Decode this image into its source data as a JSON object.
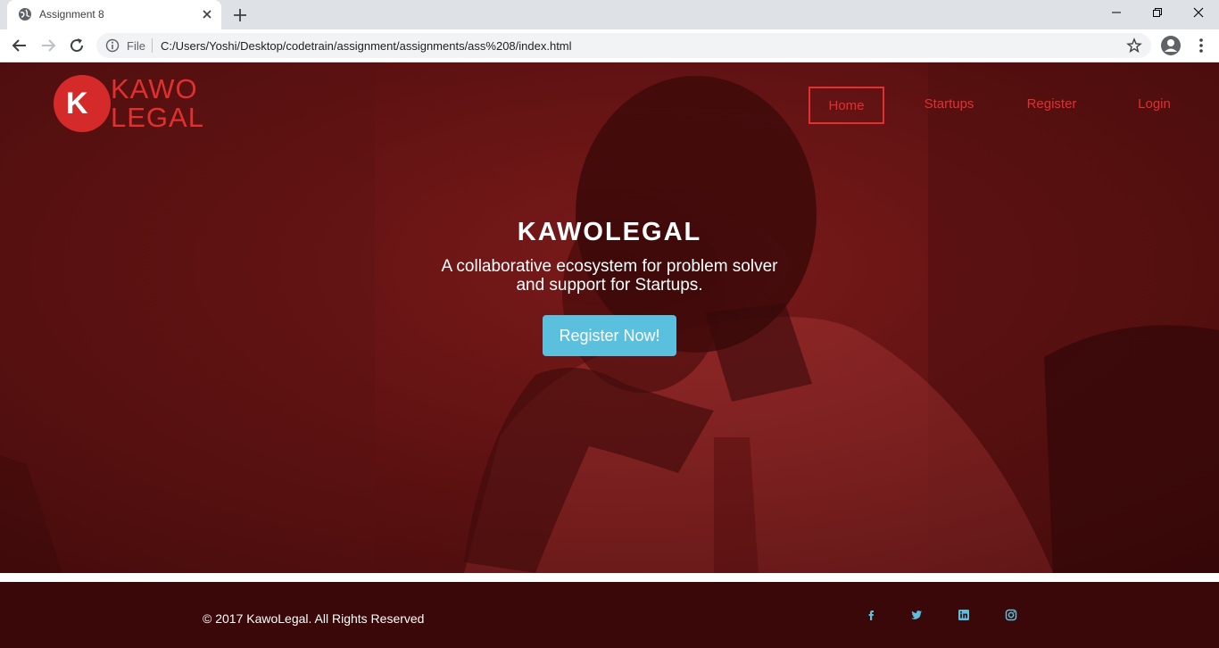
{
  "browser": {
    "tab_title": "Assignment 8",
    "scheme_label": "File",
    "url": "C:/Users/Yoshi/Desktop/codetrain/assignment/assignments/ass%208/index.html"
  },
  "site": {
    "logo": {
      "mark": "K",
      "line1": "KAWO",
      "line2": "LEGAL"
    },
    "nav": [
      {
        "label": "Home",
        "active": true
      },
      {
        "label": "Startups",
        "active": false
      },
      {
        "label": "Register",
        "active": false
      },
      {
        "label": "Login",
        "active": false
      }
    ],
    "hero": {
      "title": "KAWOLEGAL",
      "subtitle": "A collaborative ecosystem for problem solver and support for Startups.",
      "cta_label": "Register Now!"
    },
    "footer": {
      "copyright": "© 2017 KawoLegal. All Rights Reserved",
      "social_icons": [
        "facebook-icon",
        "twitter-icon",
        "linkedin-icon",
        "instagram-icon"
      ]
    }
  },
  "colors": {
    "accent_red": "#e52f2f",
    "hero_tint": "#6b1414",
    "cta_blue": "#5bc0de",
    "footer_bg": "#3b0809",
    "social_blue": "#5bc0de"
  }
}
